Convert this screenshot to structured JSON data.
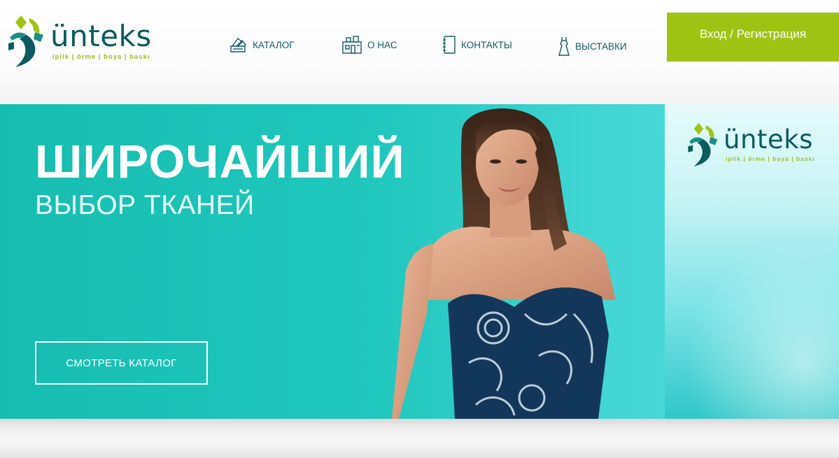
{
  "header": {
    "logo": {
      "word": "ünteks",
      "tagline": "iplik | örme | boya | baskı"
    },
    "nav": [
      {
        "label": "КАТАЛОГ",
        "icon": "swatch-icon"
      },
      {
        "label": "О НАС",
        "icon": "building-icon"
      },
      {
        "label": "КОНТАКТЫ",
        "icon": "notebook-icon"
      },
      {
        "label": "ВЫСТАВКИ",
        "icon": "dress-icon"
      }
    ],
    "login_label": "Вход / Регистрация"
  },
  "banner": {
    "headline": "ШИРОЧАЙШИЙ",
    "subline": "ВЫБОР ТКАНЕЙ",
    "cta_label": "СМОТРЕТЬ КАТАЛОГ",
    "logo": {
      "word": "ünteks",
      "tagline": "iplik | örme | boya | baskı"
    }
  },
  "colors": {
    "brand_teal": "#0b5b5f",
    "brand_green": "#9fc313",
    "banner_teal": "#20c7bd"
  }
}
